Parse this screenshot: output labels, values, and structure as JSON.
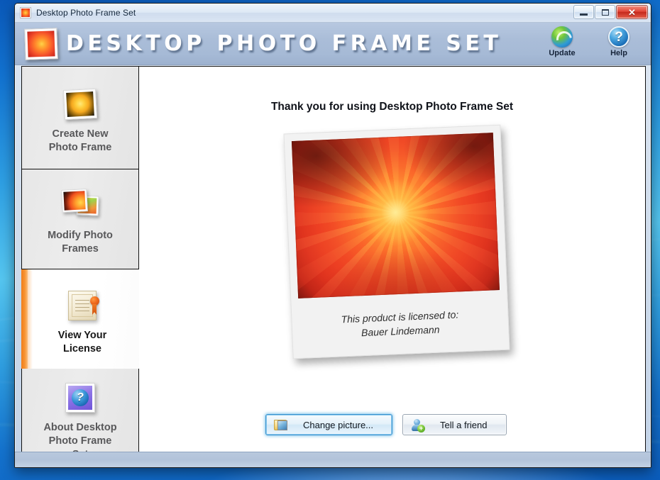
{
  "window": {
    "title": "Desktop Photo Frame Set",
    "app_icon": "photo-rose-icon",
    "controls": {
      "minimize": "minimize-button",
      "maximize": "maximize-button",
      "close_glyph": "✕"
    }
  },
  "banner": {
    "title": "DESKTOP PHOTO FRAME SET",
    "logo_icon": "rose-photo-logo-icon",
    "actions": [
      {
        "label": "Update",
        "icon": "update-refresh-icon"
      },
      {
        "label": "Help",
        "icon": "help-question-icon",
        "glyph": "?"
      }
    ]
  },
  "sidebar": {
    "items": [
      {
        "label": "Create New\nPhoto Frame",
        "line1": "Create New",
        "line2": "Photo Frame",
        "icon": "new-photo-frame-icon",
        "selected": false
      },
      {
        "label": "Modify Photo\nFrames",
        "line1": "Modify Photo",
        "line2": "Frames",
        "icon": "modify-photo-frames-icon",
        "selected": false
      },
      {
        "label": "View Your\nLicense",
        "line1": "View Your",
        "line2": "License",
        "icon": "license-certificate-icon",
        "selected": true
      },
      {
        "label": "About Desktop\nPhoto Frame\nSet",
        "line1": "About Desktop",
        "line2": "Photo Frame",
        "line3": "Set",
        "icon": "about-info-icon",
        "selected": false
      }
    ]
  },
  "content": {
    "heading": "Thank you for using Desktop Photo Frame Set",
    "photo": {
      "alt": "orange rose close-up",
      "caption_line1": "This product is licensed to:",
      "caption_line2": "Bauer Lindemann"
    },
    "buttons": [
      {
        "label": "Change picture...",
        "icon": "folder-image-icon",
        "focused": true
      },
      {
        "label": "Tell a friend",
        "icon": "add-person-icon",
        "focused": false
      }
    ]
  },
  "colors": {
    "banner_bg": "#aabdd8",
    "accent_orange": "#f07d1a",
    "sidebar_bg": "#e9e9e9",
    "content_bg": "#ffffff",
    "focus_blue": "#3c93cf",
    "close_red": "#e2483a"
  }
}
